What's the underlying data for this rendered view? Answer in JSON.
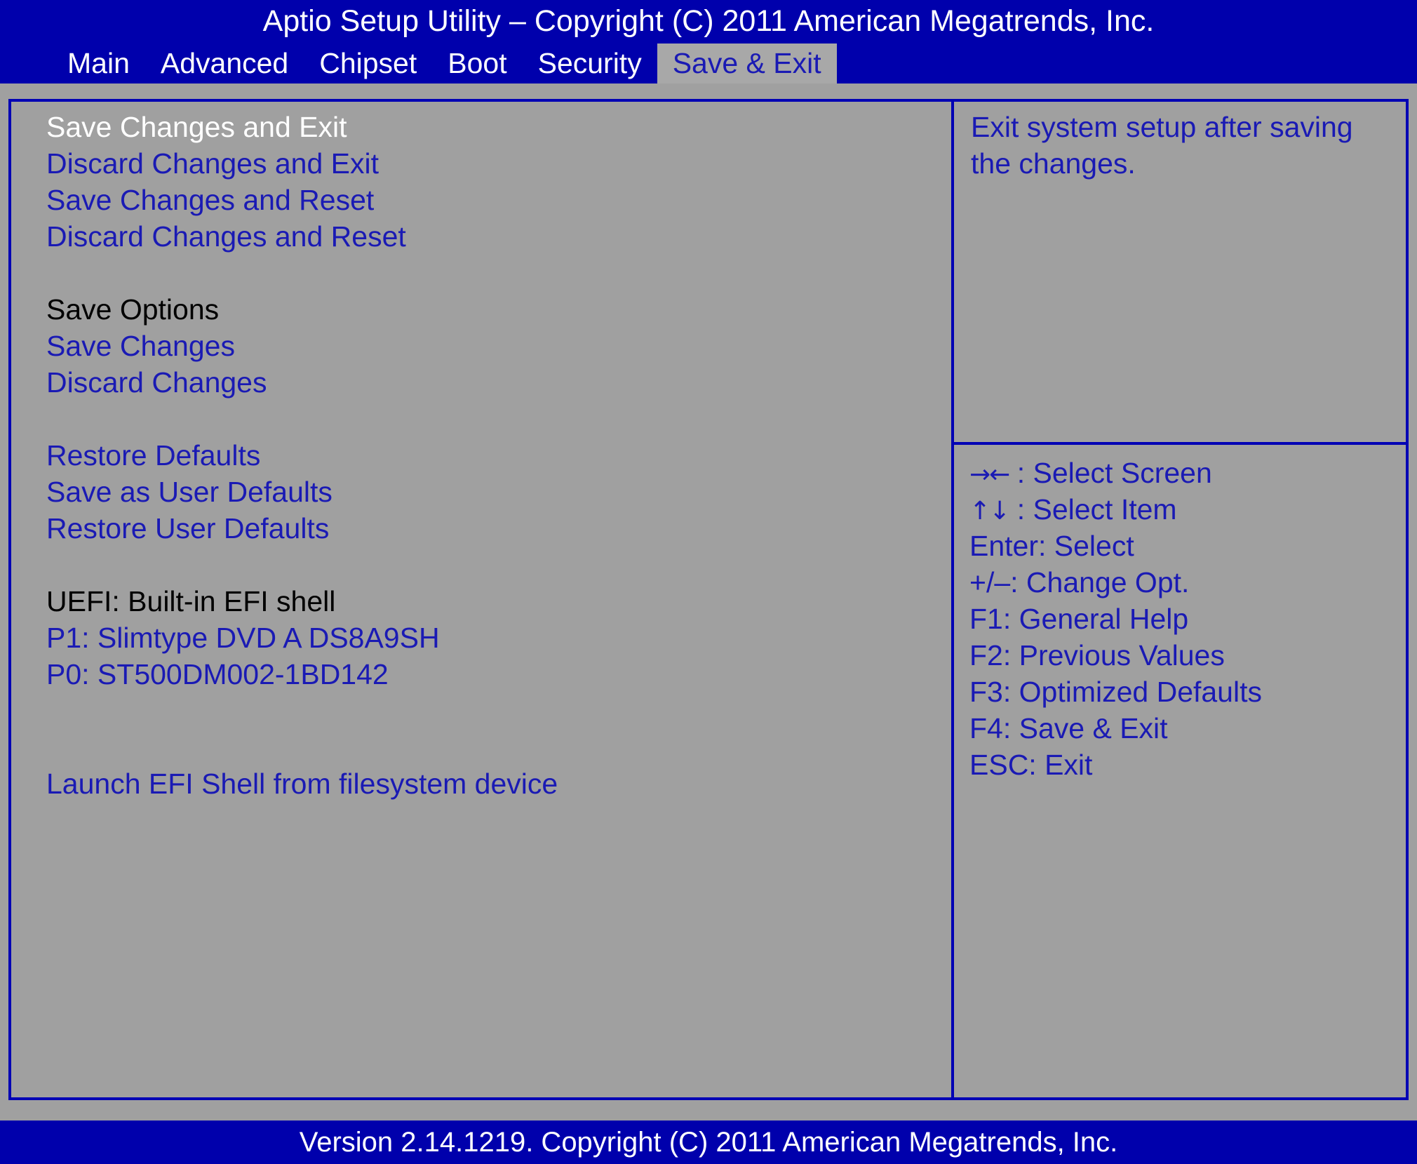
{
  "window": {
    "title": "Aptio Setup Utility – Copyright (C) 2011 American Megatrends, Inc.",
    "footer": "Version 2.14.1219. Copyright (C) 2011 American Megatrends, Inc."
  },
  "tabs": [
    {
      "label": "Main",
      "active": false
    },
    {
      "label": "Advanced",
      "active": false
    },
    {
      "label": "Chipset",
      "active": false
    },
    {
      "label": "Boot",
      "active": false
    },
    {
      "label": "Security",
      "active": false
    },
    {
      "label": "Save & Exit",
      "active": true
    }
  ],
  "menu": {
    "items": [
      {
        "label": "Save Changes and Exit",
        "style": "selected"
      },
      {
        "label": "Discard Changes and Exit",
        "style": "item"
      },
      {
        "label": "Save Changes and Reset",
        "style": "item"
      },
      {
        "label": "Discard Changes and Reset",
        "style": "item"
      },
      {
        "label": "",
        "style": "spacer"
      },
      {
        "label": "Save Options",
        "style": "header"
      },
      {
        "label": "Save Changes",
        "style": "item"
      },
      {
        "label": "Discard Changes",
        "style": "item"
      },
      {
        "label": "",
        "style": "spacer"
      },
      {
        "label": "Restore Defaults",
        "style": "item"
      },
      {
        "label": "Save as User Defaults",
        "style": "item"
      },
      {
        "label": "Restore User Defaults",
        "style": "item"
      },
      {
        "label": "",
        "style": "spacer"
      },
      {
        "label": "UEFI: Built-in EFI shell",
        "style": "header"
      },
      {
        "label": "P1: Slimtype DVD A DS8A9SH",
        "style": "item"
      },
      {
        "label": "P0: ST500DM002-1BD142",
        "style": "item"
      },
      {
        "label": "",
        "style": "spacer"
      },
      {
        "label": "",
        "style": "spacer"
      },
      {
        "label": "Launch EFI Shell from filesystem device",
        "style": "item"
      }
    ]
  },
  "help": {
    "text": "Exit system setup after saving the changes."
  },
  "legend": {
    "rows": [
      {
        "keys": "→←",
        "text": " : Select Screen"
      },
      {
        "keys": "↑↓",
        "text": " : Select Item"
      },
      {
        "keys": "",
        "text": "Enter: Select"
      },
      {
        "keys": "",
        "text": "+/–: Change Opt."
      },
      {
        "keys": "",
        "text": "F1: General Help"
      },
      {
        "keys": "",
        "text": "F2: Previous Values"
      },
      {
        "keys": "",
        "text": "F3: Optimized Defaults"
      },
      {
        "keys": "",
        "text": "F4: Save & Exit"
      },
      {
        "keys": "",
        "text": "ESC: Exit"
      }
    ]
  },
  "colors": {
    "blue_bar": "#0000ac",
    "blue_text": "#1a1ab4",
    "gray_bg": "#a0a0a0",
    "white_text": "#ffffff",
    "black_text": "#000000",
    "border": "#0000b4"
  }
}
